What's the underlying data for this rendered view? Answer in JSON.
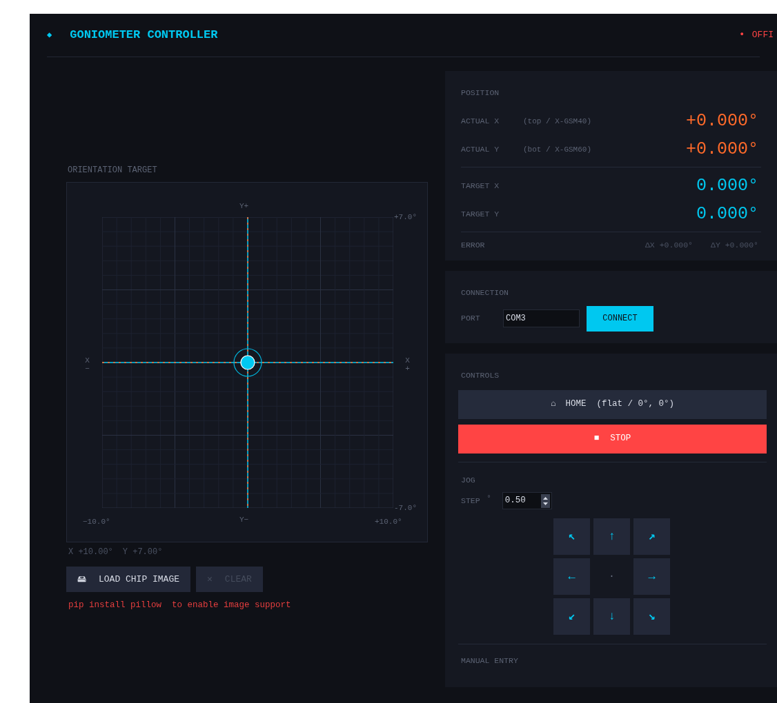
{
  "header": {
    "logo": "◆",
    "title": "GONIOMETER CONTROLLER",
    "status": {
      "online": false,
      "dot": "●",
      "text": "OFFI"
    }
  },
  "orientation": {
    "title": "ORIENTATION TARGET",
    "y_plus": "Y+",
    "y_minus": "Y−",
    "x_minus": "X−",
    "x_plus": "X+",
    "x_min": "−10.0°",
    "x_max": "+10.0°",
    "y_max": "+7.0°",
    "y_min": "-7.0°",
    "readout_x": "X +10.00°",
    "readout_y": "Y +7.00°"
  },
  "image_buttons": [
    {
      "icon": "🖴",
      "label": "LOAD CHIP IMAGE",
      "disabled": false
    },
    {
      "icon": "✕",
      "label": "CLEAR",
      "disabled": true
    }
  ],
  "hint": "pip install pillow  to enable image support",
  "position": {
    "title": "POSITION",
    "actual": [
      {
        "label": "ACTUAL X",
        "sub": "(top / X-GSM40)",
        "value": "+0.000°"
      },
      {
        "label": "ACTUAL Y",
        "sub": "(bot / X-GSM60)",
        "value": "+0.000°"
      }
    ],
    "target": [
      {
        "label": "TARGET X",
        "value": "0.000°"
      },
      {
        "label": "TARGET Y",
        "value": "0.000°"
      }
    ],
    "error": {
      "label": "ERROR",
      "dx": "ΔX +0.000°",
      "dy": "ΔY +0.000°"
    }
  },
  "connection": {
    "title": "CONNECTION",
    "port_label": "PORT",
    "port": "COM3",
    "button": "CONNECT"
  },
  "controls": {
    "title": "CONTROLS",
    "home": {
      "icon": "⌂",
      "label": "HOME  (flat / 0°, 0°)"
    },
    "stop": {
      "icon": "■",
      "label": "STOP"
    },
    "jog_title": "JOG",
    "step_label": "STEP",
    "step_unit": "°",
    "step": "0.50",
    "pad": [
      {
        "kind": "arrow",
        "glyph": "↖"
      },
      {
        "kind": "arrow",
        "glyph": "↑"
      },
      {
        "kind": "arrow",
        "glyph": "↗"
      },
      {
        "kind": "arrow",
        "glyph": "←"
      },
      {
        "kind": "center",
        "glyph": "·"
      },
      {
        "kind": "arrow",
        "glyph": "→"
      },
      {
        "kind": "arrow",
        "glyph": "↙"
      },
      {
        "kind": "arrow",
        "glyph": "↓"
      },
      {
        "kind": "arrow",
        "glyph": "↘"
      }
    ],
    "manual_title": "MANUAL ENTRY"
  }
}
